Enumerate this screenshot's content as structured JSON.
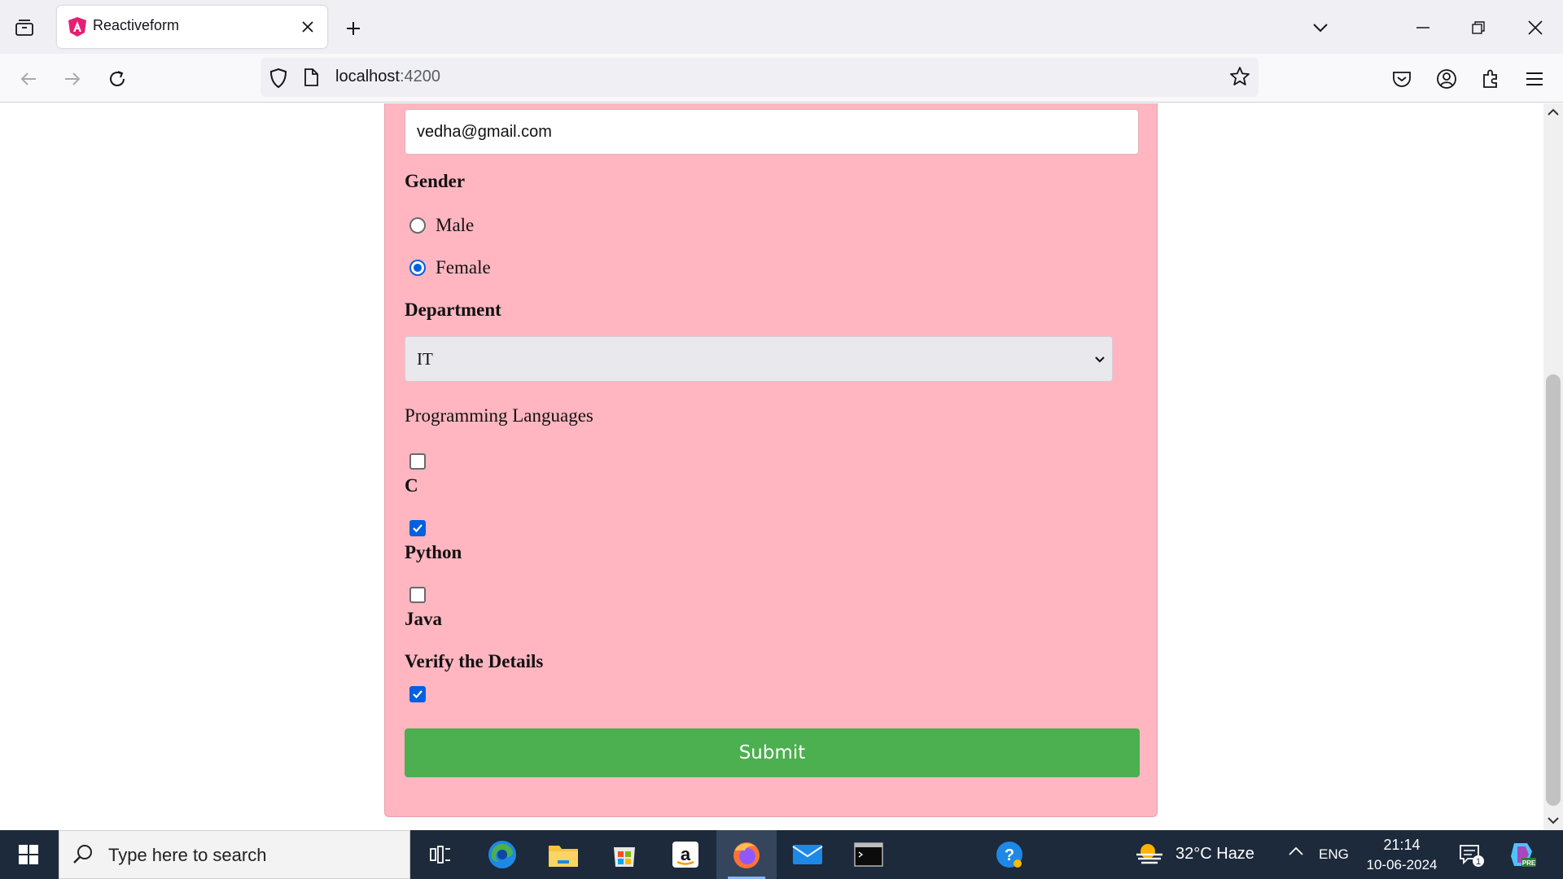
{
  "browser": {
    "tab_title": "Reactiveform",
    "url_host": "localhost",
    "url_port": ":4200"
  },
  "form": {
    "email_value": "vedha@gmail.com",
    "gender_label": "Gender",
    "gender_options": [
      {
        "label": "Male",
        "selected": false
      },
      {
        "label": "Female",
        "selected": true
      }
    ],
    "department_label": "Department",
    "department_selected": "IT",
    "languages_label": "Programming Languages",
    "languages": [
      {
        "label": "C",
        "checked": false
      },
      {
        "label": "Python",
        "checked": true
      },
      {
        "label": "Java",
        "checked": false
      }
    ],
    "verify_label": "Verify the Details",
    "verify_checked": true,
    "submit_label": "Submit"
  },
  "taskbar": {
    "search_placeholder": "Type here to search",
    "weather": "32°C  Haze",
    "language": "ENG",
    "time": "21:14",
    "date": "10-06-2024",
    "notification_count": "1"
  },
  "colors": {
    "form_background": "#ffb6c1",
    "submit_button": "#4caf50",
    "checkbox_accent": "#0060df",
    "taskbar": "#1c2a3b"
  }
}
